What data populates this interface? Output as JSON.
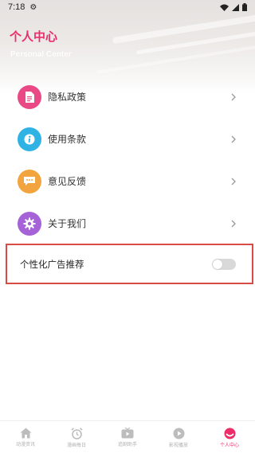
{
  "status_bar": {
    "time": "7:18"
  },
  "header": {
    "title": "个人中心",
    "subtitle": "Personal Center"
  },
  "menu": [
    {
      "label": "隐私政策",
      "icon": "document-icon",
      "color": "#e94a86"
    },
    {
      "label": "使用条款",
      "icon": "info-icon",
      "color": "#2fb3e5"
    },
    {
      "label": "意见反馈",
      "icon": "chat-icon",
      "color": "#f2a53f"
    },
    {
      "label": "关于我们",
      "icon": "gear-icon",
      "color": "#a663d8"
    }
  ],
  "ad_setting": {
    "label": "个性化广告推荐",
    "enabled": false
  },
  "tabs": [
    {
      "label": "动漫资讯",
      "icon": "home-icon",
      "active": false
    },
    {
      "label": "漫画每日",
      "icon": "alarm-clock-icon",
      "active": false
    },
    {
      "label": "追剧助手",
      "icon": "tv-icon",
      "active": false
    },
    {
      "label": "影视播放",
      "icon": "play-icon",
      "active": false
    },
    {
      "label": "个人中心",
      "icon": "profile-icon",
      "active": true
    }
  ],
  "colors": {
    "accent": "#ec2d6a",
    "highlight_border": "#d84a44"
  }
}
